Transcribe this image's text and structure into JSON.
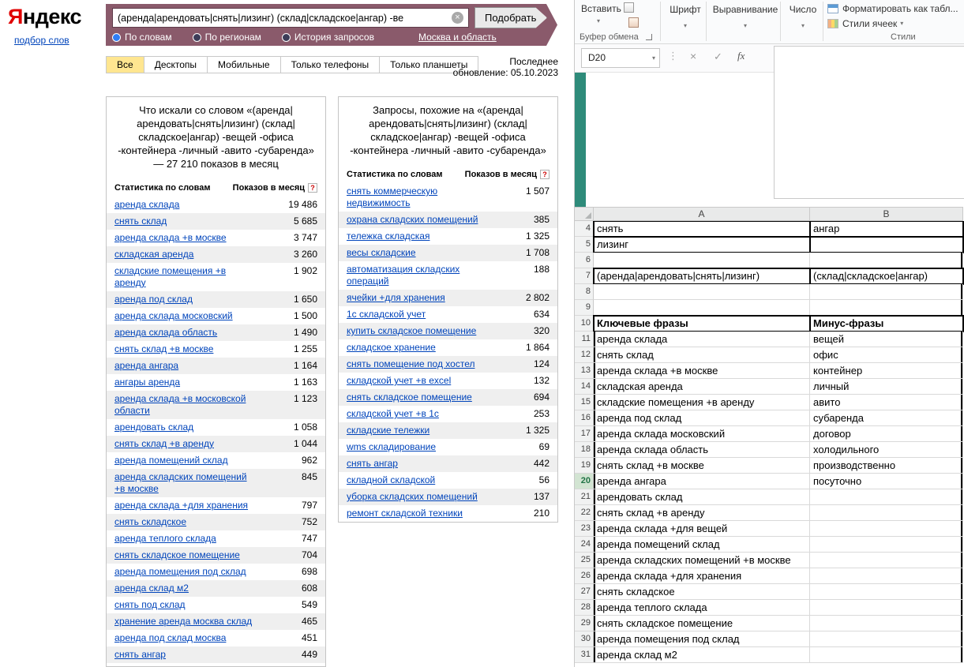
{
  "yandex": {
    "logo": {
      "first": "Я",
      "rest": "ндекс"
    },
    "nav_link": "подбор слов",
    "search": {
      "value": "(аренда|арендовать|снять|лизинг) (склад|складское|ангар) -ве",
      "button": "Подобрать"
    },
    "modes": [
      {
        "label": "По словам",
        "selected": true
      },
      {
        "label": "По регионам",
        "selected": false
      },
      {
        "label": "История запросов",
        "selected": false
      }
    ],
    "region_link": "Москва и область",
    "tabs": [
      {
        "label": "Все",
        "active": true
      },
      {
        "label": "Десктопы",
        "active": false
      },
      {
        "label": "Мобильные",
        "active": false
      },
      {
        "label": "Только телефоны",
        "active": false
      },
      {
        "label": "Только планшеты",
        "active": false
      }
    ],
    "last_update_line1": "Последнее",
    "last_update_line2": "обновление: 05.10.2023",
    "left_table": {
      "title": "Что искали со словом «(аренда|арендовать|снять|лизинг) (склад|складское|ангар) -вещей -офиса -контейнера -личный -авито -субаренда» — 27 210 показов в месяц",
      "col_terms": "Статистика по словам",
      "col_count": "Показов в месяц",
      "rows": [
        {
          "term": "аренда склада",
          "count": "19 486"
        },
        {
          "term": "снять склад",
          "count": "5 685"
        },
        {
          "term": "аренда склада +в москве",
          "count": "3 747"
        },
        {
          "term": "складская аренда",
          "count": "3 260"
        },
        {
          "term": "складские помещения +в аренду",
          "count": "1 902"
        },
        {
          "term": "аренда под склад",
          "count": "1 650"
        },
        {
          "term": "аренда склада московский",
          "count": "1 500"
        },
        {
          "term": "аренда склада область",
          "count": "1 490"
        },
        {
          "term": "снять склад +в москве",
          "count": "1 255"
        },
        {
          "term": "аренда ангара",
          "count": "1 164"
        },
        {
          "term": "ангары аренда",
          "count": "1 163"
        },
        {
          "term": "аренда склада +в московской области",
          "count": "1 123"
        },
        {
          "term": "арендовать склад",
          "count": "1 058"
        },
        {
          "term": "снять склад +в аренду",
          "count": "1 044"
        },
        {
          "term": "аренда помещений склад",
          "count": "962"
        },
        {
          "term": "аренда складских помещений +в москве",
          "count": "845"
        },
        {
          "term": "аренда склада +для хранения",
          "count": "797"
        },
        {
          "term": "снять складское",
          "count": "752"
        },
        {
          "term": "аренда теплого склада",
          "count": "747"
        },
        {
          "term": "снять складское помещение",
          "count": "704"
        },
        {
          "term": "аренда помещения под склад",
          "count": "698"
        },
        {
          "term": "аренда склад м2",
          "count": "608"
        },
        {
          "term": "снять под склад",
          "count": "549"
        },
        {
          "term": "хранение аренда москва склад",
          "count": "465"
        },
        {
          "term": "аренда под склад москва",
          "count": "451"
        },
        {
          "term": "снять ангар",
          "count": "449"
        }
      ]
    },
    "right_table": {
      "title": "Запросы, похожие на «(аренда|арендовать|снять|лизинг) (склад|складское|ангар) -вещей -офиса -контейнера -личный -авито -субаренда»",
      "col_terms": "Статистика по словам",
      "col_count": "Показов в месяц",
      "rows": [
        {
          "term": "снять коммерческую недвижимость",
          "count": "1 507"
        },
        {
          "term": "охрана складских помещений",
          "count": "385"
        },
        {
          "term": "тележка складская",
          "count": "1 325"
        },
        {
          "term": "весы складские",
          "count": "1 708"
        },
        {
          "term": "автоматизация складских операций",
          "count": "188"
        },
        {
          "term": "ячейки +для хранения",
          "count": "2 802"
        },
        {
          "term": "1с складской учет",
          "count": "634"
        },
        {
          "term": "купить складское помещение",
          "count": "320"
        },
        {
          "term": "складское хранение",
          "count": "1 864"
        },
        {
          "term": "снять помещение под хостел",
          "count": "124"
        },
        {
          "term": "складской учет +в excel",
          "count": "132"
        },
        {
          "term": "снять складское помещение",
          "count": "694"
        },
        {
          "term": "складской учет +в 1с",
          "count": "253"
        },
        {
          "term": "складские тележки",
          "count": "1 325"
        },
        {
          "term": "wms складирование",
          "count": "69"
        },
        {
          "term": "снять ангар",
          "count": "442"
        },
        {
          "term": "складной складской",
          "count": "56"
        },
        {
          "term": "уборка складских помещений",
          "count": "137"
        },
        {
          "term": "ремонт складской техники",
          "count": "210"
        }
      ]
    }
  },
  "excel": {
    "ribbon": {
      "paste": "Вставить",
      "clipboard_group": "Буфер обмена",
      "font_group": "Шрифт",
      "alignment_group": "Выравнивание",
      "number_group": "Число",
      "format_as_table": "Форматировать как табл...",
      "cell_styles": "Стили ячеек",
      "styles_group": "Стили"
    },
    "name_box": "D20",
    "fx_label": "fx",
    "formula_value": "",
    "columns": [
      "A",
      "B"
    ],
    "selected_row": 20,
    "rows": [
      {
        "n": 4,
        "a": "снять",
        "b": "ангар"
      },
      {
        "n": 5,
        "a": "лизинг",
        "b": ""
      },
      {
        "n": 6,
        "a": "",
        "b": ""
      },
      {
        "n": 7,
        "a": "(аренда|арендовать|снять|лизинг)",
        "b": "(склад|складское|ангар)"
      },
      {
        "n": 8,
        "a": "",
        "b": ""
      },
      {
        "n": 9,
        "a": "",
        "b": ""
      },
      {
        "n": 10,
        "a": "Ключевые фразы",
        "b": "Минус-фразы"
      },
      {
        "n": 11,
        "a": "аренда склада",
        "b": "вещей"
      },
      {
        "n": 12,
        "a": "снять склад",
        "b": "офис"
      },
      {
        "n": 13,
        "a": "аренда склада +в москве",
        "b": "контейнер"
      },
      {
        "n": 14,
        "a": "складская аренда",
        "b": "личный"
      },
      {
        "n": 15,
        "a": "складские помещения +в аренду",
        "b": "авито"
      },
      {
        "n": 16,
        "a": "аренда под склад",
        "b": "субаренда"
      },
      {
        "n": 17,
        "a": "аренда склада московский",
        "b": "договор"
      },
      {
        "n": 18,
        "a": "аренда склада область",
        "b": "холодильного"
      },
      {
        "n": 19,
        "a": "снять склад +в москве",
        "b": "производственно"
      },
      {
        "n": 20,
        "a": "аренда ангара",
        "b": "посуточно"
      },
      {
        "n": 21,
        "a": "арендовать склад",
        "b": ""
      },
      {
        "n": 22,
        "a": "снять склад +в аренду",
        "b": ""
      },
      {
        "n": 23,
        "a": "аренда склада +для вещей",
        "b": ""
      },
      {
        "n": 24,
        "a": "аренда помещений склад",
        "b": ""
      },
      {
        "n": 25,
        "a": "аренда складских помещений +в москве",
        "b": ""
      },
      {
        "n": 26,
        "a": "аренда склада +для хранения",
        "b": ""
      },
      {
        "n": 27,
        "a": "снять складское",
        "b": ""
      },
      {
        "n": 28,
        "a": "аренда теплого склада",
        "b": ""
      },
      {
        "n": 29,
        "a": "снять складское помещение",
        "b": ""
      },
      {
        "n": 30,
        "a": "аренда помещения под склад",
        "b": ""
      },
      {
        "n": 31,
        "a": "аренда склад м2",
        "b": ""
      }
    ]
  }
}
